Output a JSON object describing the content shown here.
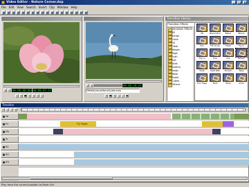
{
  "window": {
    "title": "Video Editor - Nature Corner.dvp"
  },
  "menu": [
    "File",
    "Edit",
    "View",
    "Search",
    "Insert",
    "Clip",
    "Window",
    "Help"
  ],
  "toolbar_icons": [
    "new-icon",
    "open-icon",
    "save-icon",
    "cut-icon",
    "copy-icon",
    "paste-icon",
    "undo-icon",
    "redo-icon",
    "find-icon",
    "zoom-icon",
    "clip-icon",
    "split-icon",
    "trim-icon",
    "play-icon",
    "stop-icon",
    "record-icon",
    "settings-icon",
    "help-icon"
  ],
  "source_monitor": {
    "timecode_in": "00:00:00:00",
    "timecode_out": "00:00:05:12"
  },
  "program_monitor": {
    "timecode": "00:00:28:16",
    "clip_field": "Media\\Lotus\\Heron\\Lake.mov"
  },
  "transition_panel": {
    "title": "Transition Library",
    "dropdown": "Transition Effects",
    "tree": [
      "Transition Effects",
      "3D",
      "Blinds",
      "Clock",
      "Fill",
      "Flash",
      "Mosaic",
      "Page",
      "Push",
      "Roll",
      "Slide",
      "Stretch",
      "Swap",
      "Wipe",
      "Zoom",
      "Cubes",
      "Others"
    ],
    "effects": [
      "3D",
      "Blend Pink",
      "Blend",
      "Blinds",
      "Fan",
      "Fill Circle",
      "Flash",
      "Fly In",
      "Flip In",
      "Fold",
      "Fire",
      "Mosaic",
      "Slide",
      "Split Wall",
      "Stretch",
      "Twist",
      "Turn Page",
      "Twist",
      "Warp",
      "Slide"
    ]
  },
  "timeline": {
    "title": "Timeline",
    "tracks": [
      "Va",
      "Fx",
      "Vb",
      "Tr",
      "A1",
      "A2",
      "A3"
    ],
    "clip_label": "Fly Pages"
  },
  "status": "Play from the current position to Mark Out"
}
